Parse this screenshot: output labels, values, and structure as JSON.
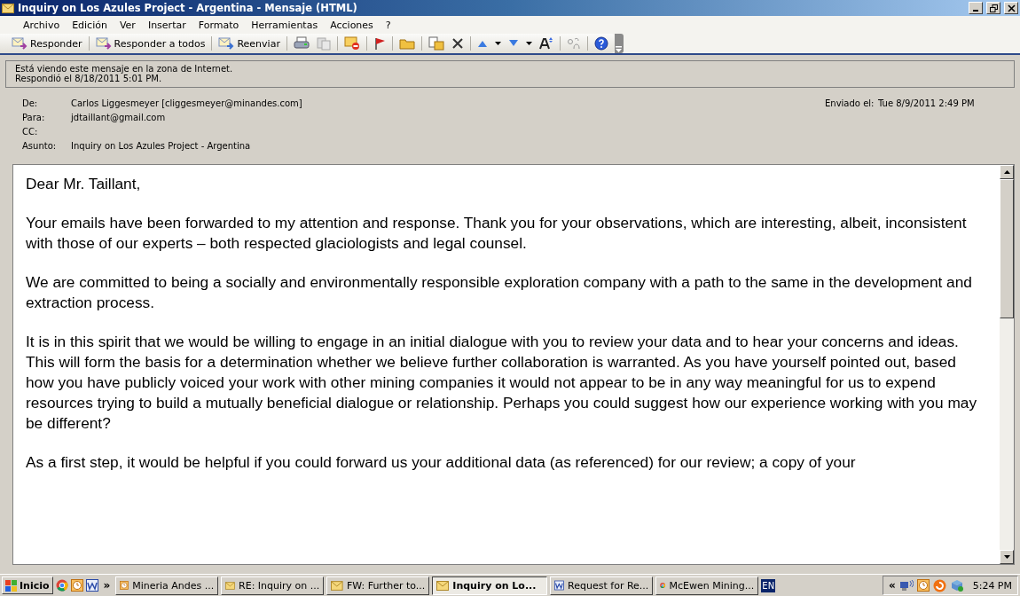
{
  "window": {
    "title": "Inquiry on Los Azules Project - Argentina - Mensaje (HTML)"
  },
  "menu": [
    {
      "label": "Archivo"
    },
    {
      "label": "Edición"
    },
    {
      "label": "Ver"
    },
    {
      "label": "Insertar"
    },
    {
      "label": "Formato"
    },
    {
      "label": "Herramientas"
    },
    {
      "label": "Acciones"
    },
    {
      "label": "?"
    }
  ],
  "toolbar": [
    {
      "label": "Responder"
    },
    {
      "label": "Responder a todos"
    },
    {
      "label": "Reenviar"
    }
  ],
  "info": [
    "Está viendo este mensaje en la zona de Internet.",
    "Respondió el 8/18/2011 5:01 PM."
  ],
  "header": {
    "fields": [
      {
        "label": "De:",
        "value": "Carlos Liggesmeyer [cliggesmeyer@minandes.com]"
      },
      {
        "label": "Para:",
        "value": "jdtaillant@gmail.com"
      },
      {
        "label": "CC:"
      },
      {
        "label": "Asunto:",
        "value": "Inquiry on Los Azules Project - Argentina"
      }
    ],
    "sent": {
      "label": "Enviado el:",
      "value": "Tue 8/9/2011 2:49 PM"
    }
  },
  "body": [
    "Dear Mr. Taillant,",
    "Your emails have been forwarded to my attention and response.  Thank you for your  observations, which are interesting, albeit, inconsistent with those of our experts – both respected glaciologists and legal counsel.",
    "We are committed to being a socially and environmentally responsible exploration company with a path to the same in the development and extraction process.",
    "It is in this spirit that we would be willing to engage in an initial dialogue with you to review your data and to hear your concerns and ideas. This will form the basis for a determination whether we believe further collaboration is warranted. As you have yourself pointed out, based how you have publicly voiced your work with other mining companies it would not appear to be in any way meaningful for us to expend resources trying to build a mutually beneficial dialogue or relationship. Perhaps you could suggest how our experience working with you may be different?",
    "As a first step, it would be helpful if you could forward us your additional data (as referenced) for our review; a copy of your"
  ],
  "taskbar": {
    "start": "Inicio",
    "more": "»",
    "tasks": [
      {
        "label": "Mineria Andes ...",
        "kind": "clock",
        "selected": false
      },
      {
        "label": "RE: Inquiry on ...",
        "kind": "mail",
        "selected": false
      },
      {
        "label": "FW: Further to...",
        "kind": "mail",
        "selected": false
      },
      {
        "label": "Inquiry on Lo...",
        "kind": "mail",
        "selected": true
      },
      {
        "label": "Request for Re...",
        "kind": "word",
        "selected": false
      },
      {
        "label": "McEwen Mining...",
        "kind": "chrome",
        "selected": false
      }
    ],
    "language": "EN",
    "expand": "«",
    "clock": "5:24 PM"
  }
}
